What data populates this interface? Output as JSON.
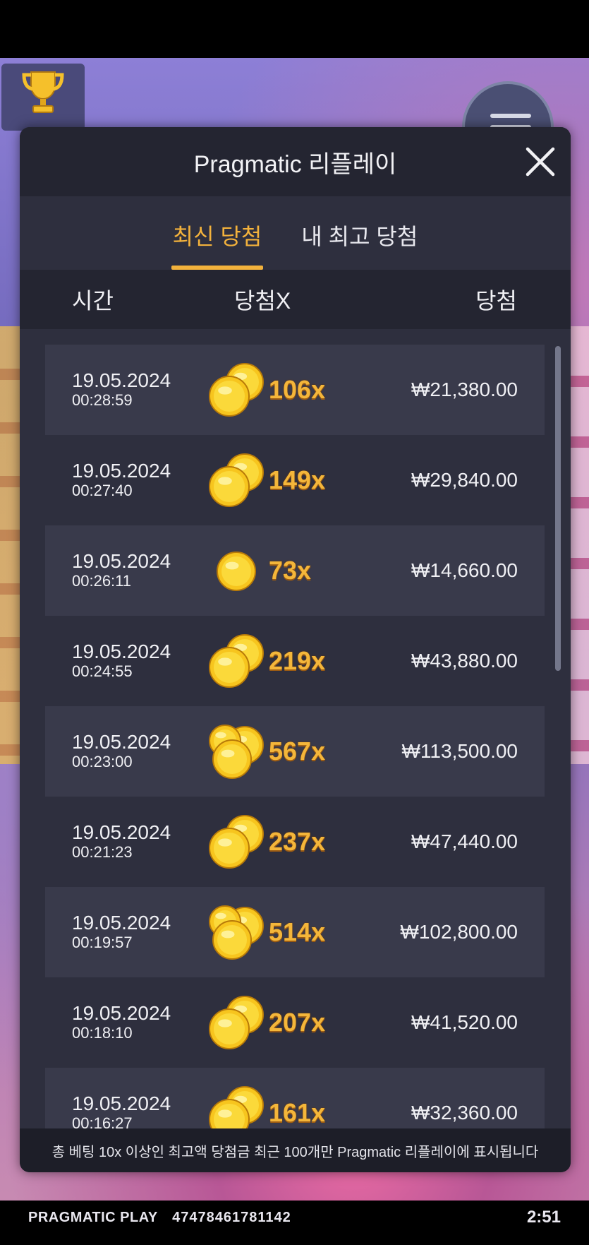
{
  "brand": "PRAGMATIC PLAY",
  "session_id": "47478461781142",
  "clock": "2:51",
  "modal": {
    "title": "Pragmatic 리플레이",
    "tabs": [
      {
        "label": "최신 당첨",
        "active": true
      },
      {
        "label": "내 최고 당첨",
        "active": false
      }
    ],
    "columns": {
      "time": "시간",
      "multiplier": "당첨X",
      "win": "당첨"
    },
    "rows": [
      {
        "date": "19.05.2024",
        "time": "00:28:59",
        "multiplier": "106x",
        "win": "₩21,380.00",
        "coins": 2
      },
      {
        "date": "19.05.2024",
        "time": "00:27:40",
        "multiplier": "149x",
        "win": "₩29,840.00",
        "coins": 2
      },
      {
        "date": "19.05.2024",
        "time": "00:26:11",
        "multiplier": "73x",
        "win": "₩14,660.00",
        "coins": 1
      },
      {
        "date": "19.05.2024",
        "time": "00:24:55",
        "multiplier": "219x",
        "win": "₩43,880.00",
        "coins": 2
      },
      {
        "date": "19.05.2024",
        "time": "00:23:00",
        "multiplier": "567x",
        "win": "₩113,500.00",
        "coins": 3
      },
      {
        "date": "19.05.2024",
        "time": "00:21:23",
        "multiplier": "237x",
        "win": "₩47,440.00",
        "coins": 2
      },
      {
        "date": "19.05.2024",
        "time": "00:19:57",
        "multiplier": "514x",
        "win": "₩102,800.00",
        "coins": 3
      },
      {
        "date": "19.05.2024",
        "time": "00:18:10",
        "multiplier": "207x",
        "win": "₩41,520.00",
        "coins": 2
      },
      {
        "date": "19.05.2024",
        "time": "00:16:27",
        "multiplier": "161x",
        "win": "₩32,360.00",
        "coins": 2
      }
    ],
    "note": "총 베팅 10x 이상인 최고액 당첨금 최근 100개만 Pragmatic 리플레이에 표시됩니다"
  },
  "colors": {
    "accent": "#f3b23c",
    "panel": "#2e2f3e",
    "header": "#242531",
    "row_alt": "#393a4b"
  },
  "icons": {
    "trophy": "trophy-icon",
    "menu": "hamburger-menu-icon",
    "close": "close-icon",
    "coin": "gold-coin-icon"
  }
}
